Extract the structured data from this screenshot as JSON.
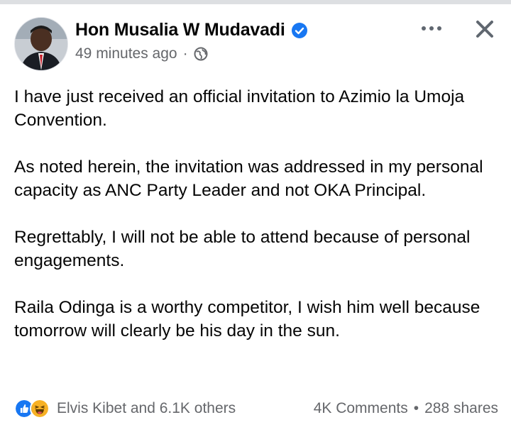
{
  "post": {
    "author": "Hon Musalia W Mudavadi",
    "time": "49 minutes ago",
    "separator": "·",
    "paragraphs": [
      "I have just received an official invitation to Azimio la Umoja Convention.",
      "As noted herein, the invitation was addressed in my personal capacity as ANC Party Leader and not OKA Principal.",
      "Regrettably, I will not be able to attend because of personal engagements.",
      "Raila Odinga is a worthy competitor, I wish him well because tomorrow will clearly be his day in the sun."
    ]
  },
  "footer": {
    "reactions_text": "Elvis Kibet and 6.1K others",
    "comments": "4K Comments",
    "dot": "•",
    "shares": "288 shares"
  },
  "icons": {
    "verified": "verified-badge-icon",
    "privacy": "globe-icon",
    "more": "more-options-icon",
    "close": "close-icon",
    "like": "like-reaction-icon",
    "haha": "haha-reaction-icon"
  },
  "colors": {
    "accent": "#1877f2",
    "text": "#050505",
    "secondary": "#65676b",
    "haha": "#f7b125"
  }
}
